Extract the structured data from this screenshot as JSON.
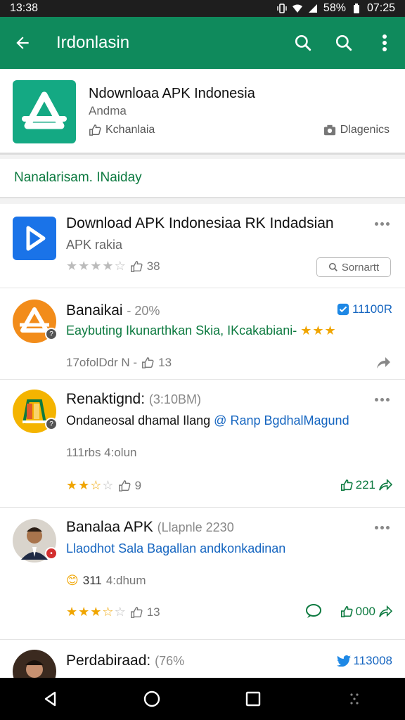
{
  "status_bar": {
    "time": "13:38",
    "battery": "58%",
    "clock": "07:25"
  },
  "appbar": {
    "title": "Irdonlasin"
  },
  "app_header": {
    "title": "Ndownloaa APK Indonesia",
    "subtitle": "Andma",
    "meta": "Kchanlaia",
    "diagnostics": "Dlagenics"
  },
  "filter": {
    "label": "Nanalarisam. INaiday"
  },
  "items": [
    {
      "name": "Download APK Indonesiaa RK Indadsian",
      "line2": "APK rakia",
      "count": "38",
      "report_label": "Sornartt"
    },
    {
      "name": "Banaikai",
      "name_extra": "- 20%",
      "badge": "11100R",
      "line2": "Eaybuting Ikunarthkan Skia, IKcakabiani-",
      "meta": "17ofolDdr Ν -",
      "count": "13"
    },
    {
      "name": "Renaktignd:",
      "name_extra": "(3:10BM)",
      "line2_a": "Ondaneosal dhamal Ilang",
      "line2_b": "Ranp BgdhalMagund",
      "meta": "111rbs 4:olun",
      "count": "9",
      "likes": "221"
    },
    {
      "name": "Banalaa APK",
      "name_extra": "(Llapnle 2230",
      "line2": "Llaodhot Sala Bagallan andkonkadinan",
      "meta_num": "311",
      "meta": "4:dhum",
      "count": "13",
      "likes": "000"
    },
    {
      "name": "Perdabiraad:",
      "name_extra": "(76%",
      "badge": "113008"
    }
  ],
  "colors": {
    "appbar": "#0f8a5c",
    "accent_green": "#0d7a40",
    "link_blue": "#1565c0",
    "star": "#f0a500"
  }
}
